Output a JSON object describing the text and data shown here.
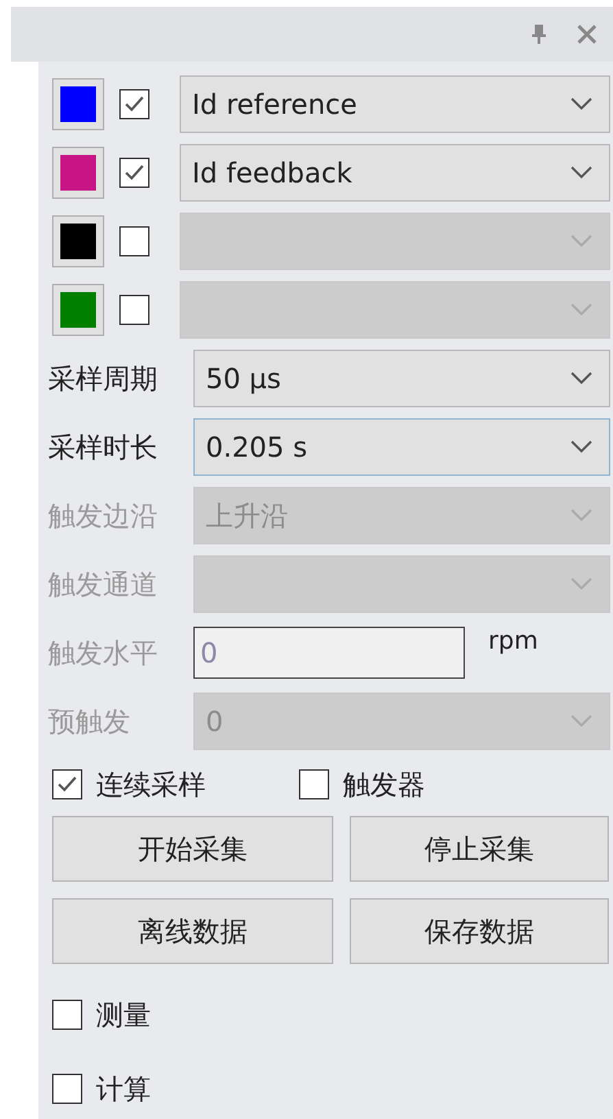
{
  "channels": [
    {
      "color": "#0000ff",
      "checked": true,
      "signal": "Id reference",
      "disabled": false
    },
    {
      "color": "#c71585",
      "checked": true,
      "signal": "Id feedback",
      "disabled": false
    },
    {
      "color": "#000000",
      "checked": false,
      "disabled": true
    },
    {
      "color": "#008000",
      "checked": false,
      "disabled": true
    }
  ],
  "settings": [
    {
      "kind": "combo",
      "label": "采样周期",
      "value": "50 μs",
      "disabled": false,
      "focused": false
    },
    {
      "kind": "combo",
      "label": "采样时长",
      "value": "0.205 s",
      "disabled": false,
      "focused": true
    },
    {
      "kind": "combo",
      "label": "触发边沿",
      "value": "上升沿",
      "disabled": true,
      "focused": false
    },
    {
      "kind": "combo",
      "label": "触发通道",
      "disabled": true,
      "focused": false
    },
    {
      "kind": "field",
      "label": "触发水平",
      "value": "0",
      "unit": "rpm",
      "disabled": true
    },
    {
      "kind": "combo",
      "label": "预触发",
      "value": "0",
      "disabled": true,
      "focused": false
    }
  ],
  "options": [
    {
      "label": "连续采样",
      "checked": true
    },
    {
      "label": "触发器",
      "checked": false
    }
  ],
  "buttons": [
    "开始采集",
    "停止采集",
    "离线数据",
    "保存数据"
  ],
  "tools": [
    {
      "label": "测量",
      "checked": false
    },
    {
      "label": "计算",
      "checked": false
    }
  ]
}
